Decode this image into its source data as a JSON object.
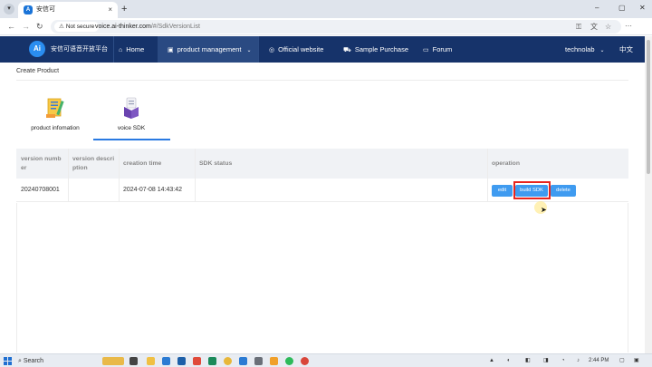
{
  "browser": {
    "tab_title": "安信可",
    "tab_close": "×",
    "new_tab": "+",
    "window_controls": [
      "–",
      "▢",
      "✕"
    ],
    "security_label": "Not secure",
    "url_host": "voice.ai-thinker.com",
    "url_path": "/#/SdkVersionList"
  },
  "header": {
    "logo_mark": "Ai",
    "logo_text": "安信可语音开放平台",
    "nav": {
      "home": "Home",
      "product_management": "product management",
      "official_website": "Official website",
      "sample_purchase": "Sample Purchase",
      "forum": "Forum",
      "user": "technolab",
      "language": "中文"
    }
  },
  "page": {
    "breadcrumb": "Create Product",
    "product_tabs": {
      "info": "product infomation",
      "sdk": "voice SDK"
    }
  },
  "table": {
    "headers": {
      "version_number_1": "version numb",
      "version_number_2": "er",
      "version_desc_1": "version descri",
      "version_desc_2": "ption",
      "creation_time": "creation time",
      "sdk_status": "SDK status",
      "operation": "operation"
    },
    "rows": [
      {
        "version_number": "20240708001",
        "version_description": "",
        "creation_time": "2024-07-08 14:43:42",
        "sdk_status": ""
      }
    ],
    "buttons": {
      "edit": "edit",
      "build_sdk": "build SDK",
      "delete": "delete"
    }
  },
  "taskbar": {
    "search": "Search",
    "time": "2:44 PM"
  },
  "colors": {
    "header_bg": "#16336a",
    "button_blue": "#3f9bf0",
    "highlight_red": "#e8251e",
    "tab_underline": "#2a7ae2"
  }
}
